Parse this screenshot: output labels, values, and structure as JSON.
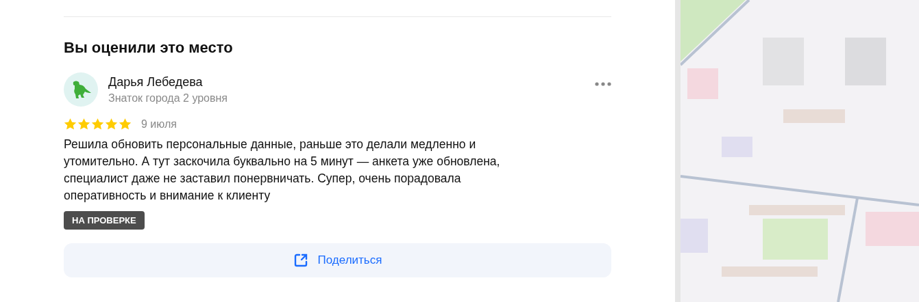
{
  "section": {
    "title": "Вы оценили это место"
  },
  "review": {
    "author": "Дарья Лебедева",
    "author_level": "Знаток города 2 уровня",
    "stars": 5,
    "date": "9 июля",
    "text": "Решила обновить персональные данные, раньше это делали медленно и утомительно. А тут заскочила буквально на 5 минут — анкета уже обновлена, специалист даже не заставил понервничать. Супер, очень порадовала оперативность и внимание к клиенту",
    "status_badge": "НА ПРОВЕРКЕ"
  },
  "share_button": {
    "label": "Поделиться"
  }
}
